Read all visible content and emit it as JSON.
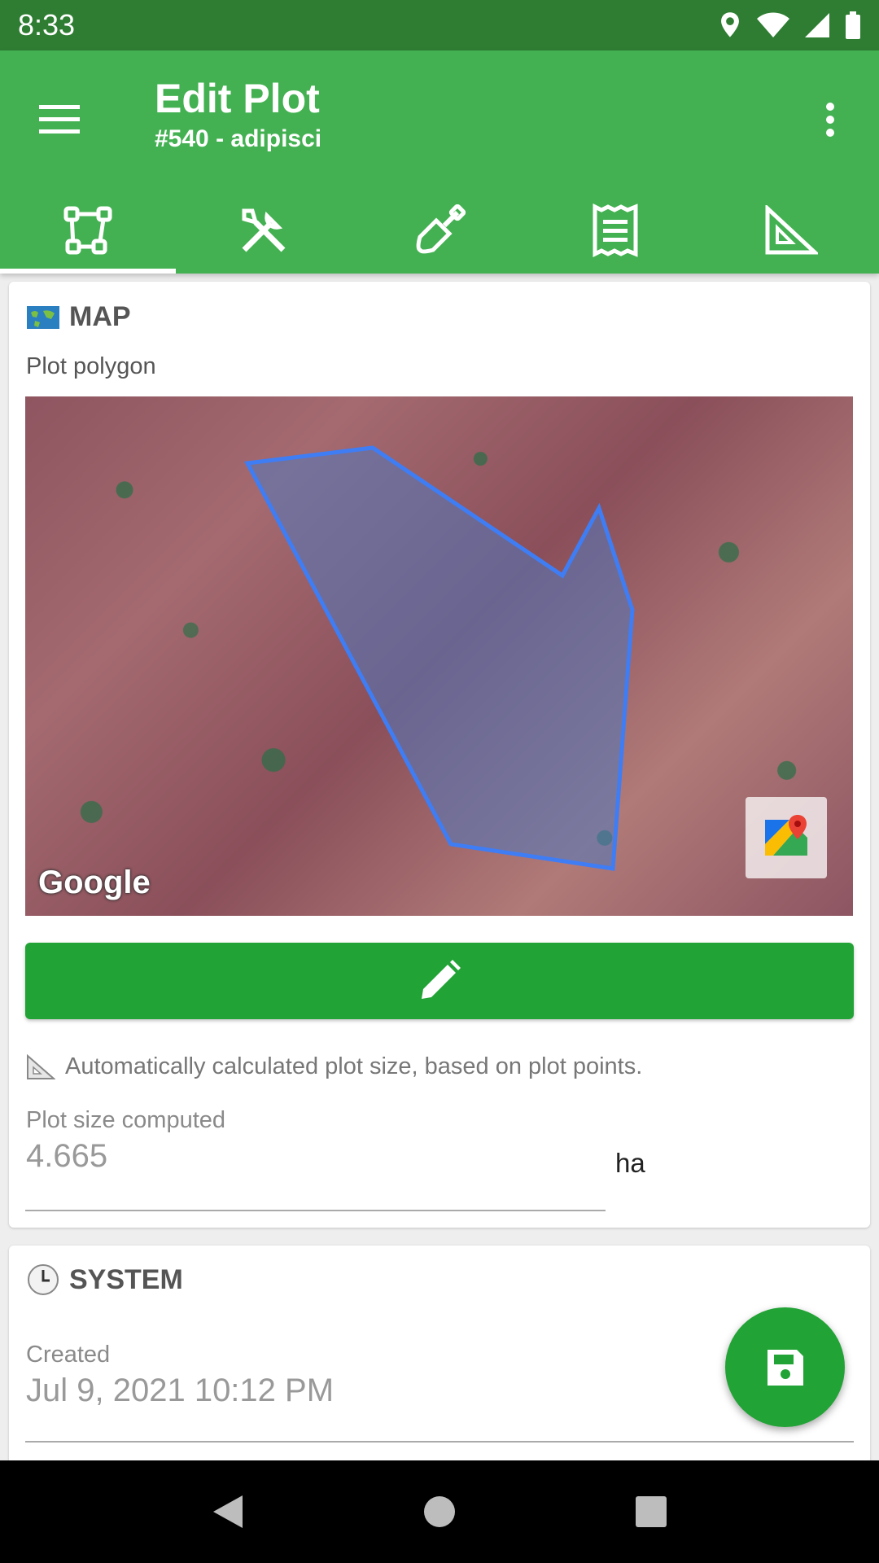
{
  "status_bar": {
    "time": "8:33",
    "icons": [
      "location-icon",
      "wifi-icon",
      "signal-icon",
      "battery-icon"
    ]
  },
  "app_bar": {
    "title": "Edit Plot",
    "subtitle": "#540 - adipisci",
    "menu_icon": "menu-icon",
    "overflow_icon": "more-vert-icon",
    "tabs": [
      {
        "icon": "polygon-icon",
        "active": true
      },
      {
        "icon": "tools-icon",
        "active": false
      },
      {
        "icon": "shovel-icon",
        "active": false
      },
      {
        "icon": "receipt-icon",
        "active": false
      },
      {
        "icon": "ruler-triangle-icon",
        "active": false
      }
    ]
  },
  "map_section": {
    "emoji": "🗺",
    "heading": "MAP",
    "label": "Plot polygon",
    "google_logo": "Google",
    "edit_icon": "pencil-icon",
    "auto_note_emoji": "📐",
    "auto_note": "Automatically calculated plot size, based on plot points.",
    "plot_size_label": "Plot size computed",
    "plot_size_value": "4.665",
    "plot_size_unit": "ha"
  },
  "system_section": {
    "emoji": "🕒",
    "heading": "SYSTEM",
    "created_label": "Created",
    "created_value": "Jul 9, 2021 10:12 PM"
  },
  "fab": {
    "icon": "save-icon"
  },
  "nav_bar": {
    "icons": [
      "back-icon",
      "home-icon",
      "recents-icon"
    ]
  },
  "colors": {
    "status_bar": "#2e7d32",
    "app_bar": "#43b152",
    "accent": "#21a335",
    "polygon_stroke": "#3f7df5"
  }
}
